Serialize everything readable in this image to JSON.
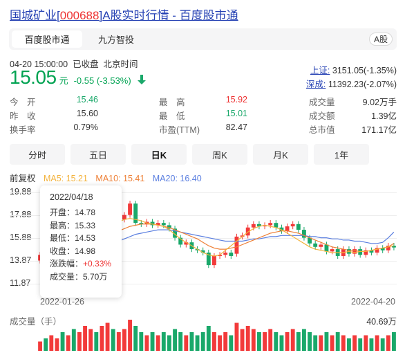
{
  "title": {
    "name": "国城矿业",
    "code_open": "[",
    "code": "000688",
    "code_close": "]",
    "rest": "A股实时行情 - 百度股市通"
  },
  "tabs": {
    "active": "百度股市通",
    "other": "九方智投",
    "badge": "A股"
  },
  "status": {
    "time": "04-20 15:00:00",
    "state": "已收盘",
    "zone": "北京时间"
  },
  "price": {
    "value": "15.05",
    "unit": "元",
    "change": "-0.55 (-3.53%)"
  },
  "indices": [
    {
      "name": "上证:",
      "value": "3151.05(-1.35%)"
    },
    {
      "name": "深成:",
      "value": "11392.23(-2.07%)"
    }
  ],
  "stats": {
    "open": {
      "label": "今　开",
      "value": "15.46"
    },
    "prev": {
      "label": "昨　收",
      "value": "15.60"
    },
    "turnover": {
      "label": "换手率",
      "value": "0.79%"
    },
    "high": {
      "label": "最　高",
      "value": "15.92"
    },
    "low": {
      "label": "最　低",
      "value": "15.01"
    },
    "pe": {
      "label": "市盈(TTM)",
      "value": "82.47"
    },
    "volume": {
      "label": "成交量",
      "value": "9.02万手"
    },
    "amount": {
      "label": "成交额",
      "value": "1.39亿"
    },
    "mcap": {
      "label": "总市值",
      "value": "171.17亿"
    }
  },
  "periods": [
    "分时",
    "五日",
    "日K",
    "周K",
    "月K",
    "1年"
  ],
  "active_period": "日K",
  "ma": {
    "adjust": "前复权",
    "ma5": "MA5: 15.21",
    "ma10": "MA10: 15.41",
    "ma20": "MA20: 16.40"
  },
  "colors": {
    "up": "#f23a3a",
    "down": "#1aa86a",
    "ma5": "#f3b23b",
    "ma10": "#ee7f35",
    "ma20": "#5b7fe0",
    "link": "#2440b3"
  },
  "chart_data": {
    "type": "candlestick",
    "y_ticks": [
      "19.88",
      "17.88",
      "15.88",
      "13.87",
      "11.87"
    ],
    "ylim": [
      11.87,
      19.88
    ],
    "x_start": "2022-01-26",
    "x_end": "2022-04-20",
    "candles": [
      {
        "o": 13.9,
        "c": 14.4
      },
      {
        "o": 14.4,
        "c": 14.1
      },
      {
        "o": 14.1,
        "c": 14.6
      },
      {
        "o": 14.6,
        "c": 15.0
      },
      {
        "o": 15.0,
        "c": 14.8
      },
      {
        "o": 14.8,
        "c": 15.4
      },
      {
        "o": 15.4,
        "c": 15.2
      },
      {
        "o": 15.2,
        "c": 15.7
      },
      {
        "o": 15.7,
        "c": 16.3
      },
      {
        "o": 16.3,
        "c": 16.6
      },
      {
        "o": 16.6,
        "c": 16.2
      },
      {
        "o": 16.2,
        "c": 16.8
      },
      {
        "o": 16.8,
        "c": 17.4
      },
      {
        "o": 17.4,
        "c": 17.0
      },
      {
        "o": 17.0,
        "c": 17.5
      },
      {
        "o": 17.5,
        "c": 17.9
      },
      {
        "o": 17.9,
        "c": 18.9
      },
      {
        "o": 18.9,
        "c": 17.2
      },
      {
        "o": 17.2,
        "c": 17.1
      },
      {
        "o": 17.1,
        "c": 17.3
      },
      {
        "o": 17.3,
        "c": 17.0
      },
      {
        "o": 17.0,
        "c": 17.2
      },
      {
        "o": 17.2,
        "c": 17.0
      },
      {
        "o": 17.0,
        "c": 16.7
      },
      {
        "o": 16.7,
        "c": 15.9
      },
      {
        "o": 15.9,
        "c": 15.3
      },
      {
        "o": 15.3,
        "c": 15.5
      },
      {
        "o": 15.5,
        "c": 14.9
      },
      {
        "o": 14.9,
        "c": 14.8
      },
      {
        "o": 14.8,
        "c": 14.6
      },
      {
        "o": 14.6,
        "c": 13.5
      },
      {
        "o": 13.5,
        "c": 14.3
      },
      {
        "o": 14.3,
        "c": 14.4
      },
      {
        "o": 14.4,
        "c": 14.6
      },
      {
        "o": 14.6,
        "c": 14.3
      },
      {
        "o": 14.5,
        "c": 16.0
      },
      {
        "o": 16.0,
        "c": 16.1
      },
      {
        "o": 16.1,
        "c": 16.8
      },
      {
        "o": 16.8,
        "c": 17.1
      },
      {
        "o": 17.1,
        "c": 16.9
      },
      {
        "o": 16.9,
        "c": 17.0
      },
      {
        "o": 17.0,
        "c": 17.2
      },
      {
        "o": 17.2,
        "c": 16.8
      },
      {
        "o": 16.8,
        "c": 16.5
      },
      {
        "o": 16.5,
        "c": 16.9
      },
      {
        "o": 16.9,
        "c": 17.1
      },
      {
        "o": 17.1,
        "c": 16.6
      },
      {
        "o": 16.6,
        "c": 15.9
      },
      {
        "o": 15.9,
        "c": 15.4
      },
      {
        "o": 15.4,
        "c": 15.1
      },
      {
        "o": 15.1,
        "c": 15.3
      },
      {
        "o": 15.3,
        "c": 14.7
      },
      {
        "o": 14.7,
        "c": 14.9
      },
      {
        "o": 14.9,
        "c": 14.3
      },
      {
        "o": 14.3,
        "c": 14.9
      },
      {
        "o": 14.9,
        "c": 14.5
      },
      {
        "o": 14.5,
        "c": 14.9
      },
      {
        "o": 14.9,
        "c": 14.4
      },
      {
        "o": 14.4,
        "c": 14.8
      },
      {
        "o": 14.8,
        "c": 14.6
      },
      {
        "o": 14.6,
        "c": 15.0
      },
      {
        "o": 15.0,
        "c": 14.8
      },
      {
        "o": 14.8,
        "c": 15.2
      },
      {
        "o": 15.2,
        "c": 15.05
      }
    ],
    "ma5": [
      14.2,
      14.3,
      14.4,
      14.5,
      14.7,
      14.9,
      15.1,
      15.4,
      15.7,
      16.0,
      16.3,
      16.6,
      16.9,
      17.1,
      17.3,
      17.5,
      17.6,
      17.5,
      17.4,
      17.2,
      17.1,
      17.0,
      16.9,
      16.6,
      16.2,
      15.8,
      15.5,
      15.2,
      14.9,
      14.6,
      14.4,
      14.3,
      14.4,
      14.8,
      15.2,
      15.6,
      16.0,
      16.4,
      16.7,
      16.9,
      17.0,
      16.9,
      16.8,
      16.6,
      16.3,
      16.0,
      15.7,
      15.4,
      15.1,
      14.9,
      14.8,
      14.7,
      14.6,
      14.6,
      14.6,
      14.7,
      14.6,
      14.7,
      14.7,
      14.8,
      14.9,
      15.0,
      15.1,
      15.2
    ],
    "ma10": [
      14.0,
      14.1,
      14.2,
      14.3,
      14.4,
      14.5,
      14.7,
      14.9,
      15.1,
      15.3,
      15.5,
      15.8,
      16.1,
      16.3,
      16.5,
      16.7,
      16.9,
      17.0,
      17.1,
      17.1,
      17.1,
      17.0,
      16.9,
      16.8,
      16.6,
      16.4,
      16.2,
      16.0,
      15.8,
      15.5,
      15.2,
      15.0,
      14.9,
      14.9,
      15.0,
      15.1,
      15.3,
      15.5,
      15.7,
      15.9,
      16.1,
      16.3,
      16.4,
      16.5,
      16.5,
      16.4,
      16.3,
      16.1,
      15.9,
      15.7,
      15.5,
      15.3,
      15.1,
      15.0,
      14.9,
      14.8,
      14.8,
      14.7,
      14.7,
      14.8,
      14.9,
      15.0,
      15.1,
      15.4
    ],
    "ma20": [
      13.6,
      13.7,
      13.8,
      13.9,
      14.0,
      14.1,
      14.2,
      14.3,
      14.5,
      14.6,
      14.8,
      15.0,
      15.2,
      15.4,
      15.6,
      15.8,
      16.0,
      16.2,
      16.3,
      16.4,
      16.5,
      16.6,
      16.6,
      16.6,
      16.5,
      16.4,
      16.3,
      16.2,
      16.1,
      16.0,
      15.9,
      15.8,
      15.7,
      15.6,
      15.6,
      15.6,
      15.6,
      15.7,
      15.8,
      15.8,
      15.9,
      16.0,
      16.0,
      16.1,
      16.1,
      16.1,
      16.1,
      16.1,
      16.0,
      16.0,
      15.9,
      15.9,
      15.8,
      15.8,
      15.7,
      15.7,
      15.6,
      15.6,
      15.5,
      15.4,
      15.4,
      15.5,
      15.9,
      16.4
    ],
    "volumes": [
      0.3,
      0.4,
      0.5,
      0.4,
      0.6,
      0.5,
      0.7,
      0.6,
      0.8,
      0.7,
      0.6,
      0.8,
      0.9,
      0.7,
      0.6,
      0.7,
      1.0,
      0.8,
      0.6,
      0.5,
      0.6,
      0.5,
      0.6,
      0.5,
      0.7,
      0.6,
      0.5,
      0.6,
      0.5,
      0.6,
      0.8,
      0.6,
      0.5,
      0.6,
      0.5,
      0.9,
      0.7,
      0.8,
      0.7,
      0.6,
      0.6,
      0.7,
      0.6,
      0.5,
      0.6,
      0.7,
      0.6,
      0.7,
      0.6,
      0.5,
      0.5,
      0.6,
      0.5,
      0.6,
      0.5,
      0.4,
      0.5,
      0.4,
      0.5,
      0.4,
      0.5,
      0.4,
      0.5,
      0.6
    ]
  },
  "tooltip": {
    "date": "2022/04/18",
    "open": "开盘：14.78",
    "high": "最高：15.33",
    "low": "最低：14.53",
    "close": "收盘：14.98",
    "pct_label": "涨跌幅：",
    "pct_value": "+0.33%",
    "vol": "成交量：5.70万"
  },
  "volume": {
    "label": "成交量（手）",
    "max": "40.69万"
  }
}
